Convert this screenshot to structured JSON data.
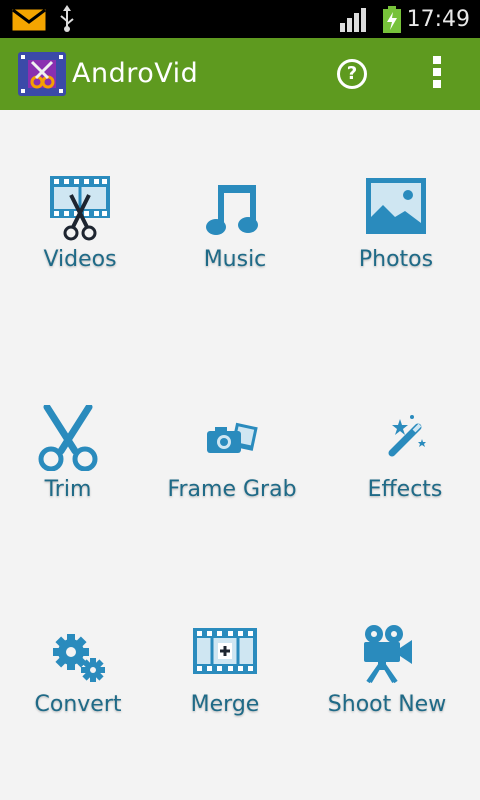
{
  "status_bar": {
    "time": "17:49",
    "icons": [
      "email-icon",
      "usb-icon",
      "signal-icon",
      "battery-charging-icon"
    ]
  },
  "app_bar": {
    "title": "AndroVid",
    "help_label": "?",
    "icons": [
      "androvid-logo",
      "help-icon",
      "overflow-menu-icon"
    ]
  },
  "colors": {
    "app_bar": "#5e9a1f",
    "icon_blue": "#2a8bbd",
    "label_blue": "#1f6a87",
    "background": "#f3f3f3"
  },
  "menu": [
    {
      "label": "Videos",
      "icon": "film-scissors-icon"
    },
    {
      "label": "Music",
      "icon": "music-note-icon"
    },
    {
      "label": "Photos",
      "icon": "picture-icon"
    },
    {
      "label": "Trim",
      "icon": "scissors-icon"
    },
    {
      "label": "Frame Grab",
      "icon": "camera-photos-icon"
    },
    {
      "label": "Effects",
      "icon": "magic-wand-icon"
    },
    {
      "label": "Convert",
      "icon": "gears-icon"
    },
    {
      "label": "Merge",
      "icon": "film-plus-icon"
    },
    {
      "label": "Shoot New",
      "icon": "video-camera-icon"
    }
  ]
}
